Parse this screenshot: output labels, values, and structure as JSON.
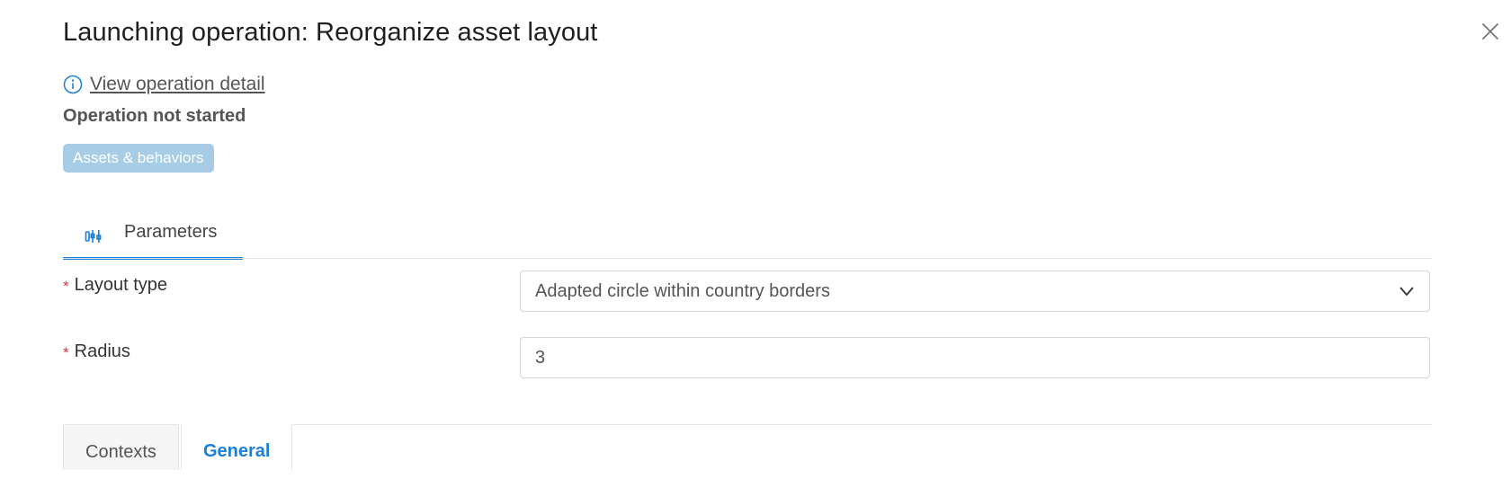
{
  "dialog": {
    "title": "Launching operation: Reorganize asset layout",
    "close_icon": "close-icon"
  },
  "detail": {
    "icon": "info-icon",
    "link_text": "View operation detail"
  },
  "status_text": "Operation not started",
  "badge": {
    "label": "Assets & behaviors",
    "color": "#a6cce6"
  },
  "parameters_tab": {
    "icon": "parameters-icon",
    "label": "Parameters",
    "accent": "#1a7fd9"
  },
  "fields": {
    "layout_type": {
      "required_mark": "*",
      "label": "Layout type",
      "value": "Adapted circle within country borders"
    },
    "radius": {
      "required_mark": "*",
      "label": "Radius",
      "value": "3"
    }
  },
  "bottom_tabs": [
    {
      "label": "Contexts",
      "active": false
    },
    {
      "label": "General",
      "active": true
    }
  ]
}
